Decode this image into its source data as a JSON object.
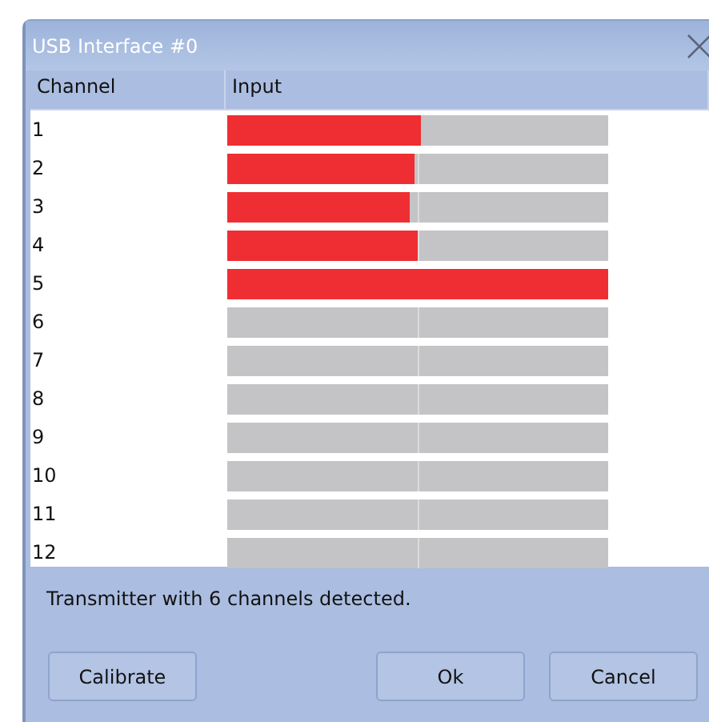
{
  "window": {
    "title": "USB Interface #0"
  },
  "table": {
    "columns": [
      "Channel",
      "Input"
    ],
    "rows": [
      {
        "channel": "1",
        "level": 0.51
      },
      {
        "channel": "2",
        "level": 0.49
      },
      {
        "channel": "3",
        "level": 0.48
      },
      {
        "channel": "4",
        "level": 0.5
      },
      {
        "channel": "5",
        "level": 1
      },
      {
        "channel": "6",
        "level": 0
      },
      {
        "channel": "7",
        "level": 0
      },
      {
        "channel": "8",
        "level": 0
      },
      {
        "channel": "9",
        "level": 0
      },
      {
        "channel": "10",
        "level": 0
      },
      {
        "channel": "11",
        "level": 0
      },
      {
        "channel": "12",
        "level": 0
      }
    ]
  },
  "status": "Transmitter with 6 channels detected.",
  "buttons": [
    {
      "label": "Calibrate"
    },
    {
      "label": "Ok"
    },
    {
      "label": "Cancel"
    }
  ]
}
